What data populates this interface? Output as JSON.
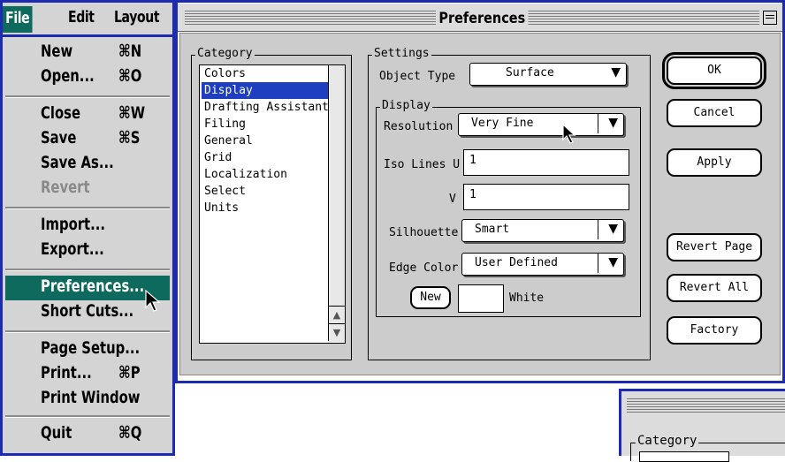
{
  "menubar": {
    "items": [
      "File",
      "Edit",
      "Layout"
    ]
  },
  "menu": {
    "items": [
      {
        "label": "New",
        "shortcut": "⌘N",
        "disabled": false
      },
      {
        "label": "Open...",
        "shortcut": "⌘O",
        "disabled": false
      },
      {
        "label": "Close",
        "shortcut": "⌘W",
        "disabled": false
      },
      {
        "label": "Save",
        "shortcut": "⌘S",
        "disabled": false
      },
      {
        "label": "Save As...",
        "shortcut": "",
        "disabled": false
      },
      {
        "label": "Revert",
        "shortcut": "",
        "disabled": true
      },
      {
        "label": "Import...",
        "shortcut": "",
        "disabled": false
      },
      {
        "label": "Export...",
        "shortcut": "",
        "disabled": false
      },
      {
        "label": "Preferences...",
        "shortcut": "",
        "disabled": false,
        "highlighted": true
      },
      {
        "label": "Short Cuts...",
        "shortcut": "",
        "disabled": false
      },
      {
        "label": "Page Setup...",
        "shortcut": "",
        "disabled": false
      },
      {
        "label": "Print...",
        "shortcut": "⌘P",
        "disabled": false
      },
      {
        "label": "Print Window",
        "shortcut": "",
        "disabled": false
      },
      {
        "label": "Quit",
        "shortcut": "⌘Q",
        "disabled": false
      }
    ]
  },
  "dialog": {
    "title": "Preferences",
    "category": {
      "label": "Category",
      "items": [
        "Colors",
        "Display",
        "Drafting Assistant",
        "Filing",
        "General",
        "Grid",
        "Localization",
        "Select",
        "Units"
      ],
      "selected": "Display"
    },
    "settings": {
      "label": "Settings",
      "object_type_label": "Object Type",
      "object_type_value": "Surface",
      "display": {
        "label": "Display",
        "resolution_label": "Resolution",
        "resolution_value": "Very Fine",
        "iso_u_label": "Iso Lines U",
        "iso_u_value": "1",
        "iso_v_label": "V",
        "iso_v_value": "1",
        "silhouette_label": "Silhouette",
        "silhouette_value": "Smart",
        "edge_color_label": "Edge Color",
        "edge_color_value": "User Defined",
        "new_button": "New",
        "color_name": "White"
      }
    },
    "buttons": {
      "ok": "OK",
      "cancel": "Cancel",
      "apply": "Apply",
      "revert_page": "Revert Page",
      "revert_all": "Revert All",
      "factory": "Factory"
    }
  },
  "second_window": {
    "category_label": "Category"
  },
  "colors": {
    "menu_highlight": "#0f6a5e",
    "list_selection": "#1d3fc0",
    "window_border": "#1d2bb0"
  }
}
